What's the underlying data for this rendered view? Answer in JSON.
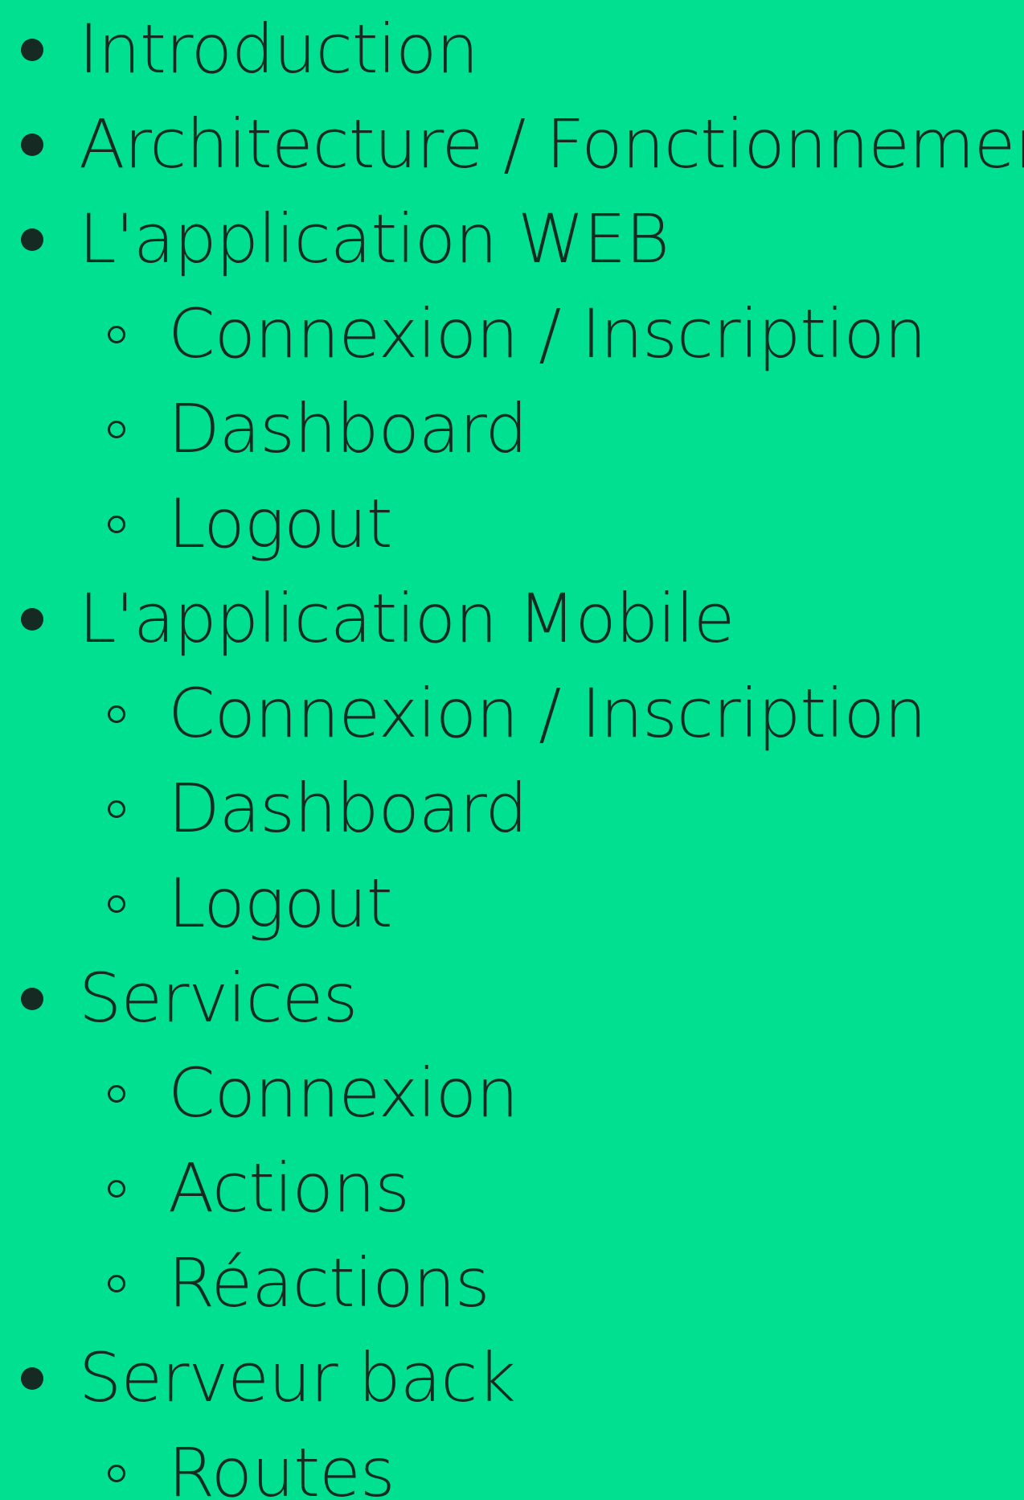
{
  "toc": {
    "items": [
      {
        "label": "Introduction",
        "level": 1,
        "icon": "disc-bullet-icon"
      },
      {
        "label": "Architecture / Fonctionnement",
        "level": 1,
        "icon": "disc-bullet-icon"
      },
      {
        "label": "L'application WEB",
        "level": 1,
        "icon": "disc-bullet-icon"
      },
      {
        "label": "Connexion / Inscription",
        "level": 2,
        "icon": "circle-bullet-icon"
      },
      {
        "label": "Dashboard",
        "level": 2,
        "icon": "circle-bullet-icon"
      },
      {
        "label": "Logout",
        "level": 2,
        "icon": "circle-bullet-icon"
      },
      {
        "label": "L'application Mobile",
        "level": 1,
        "icon": "disc-bullet-icon"
      },
      {
        "label": "Connexion / Inscription",
        "level": 2,
        "icon": "circle-bullet-icon"
      },
      {
        "label": "Dashboard",
        "level": 2,
        "icon": "circle-bullet-icon"
      },
      {
        "label": "Logout",
        "level": 2,
        "icon": "circle-bullet-icon"
      },
      {
        "label": "Services",
        "level": 1,
        "icon": "disc-bullet-icon"
      },
      {
        "label": "Connexion",
        "level": 2,
        "icon": "circle-bullet-icon"
      },
      {
        "label": "Actions",
        "level": 2,
        "icon": "circle-bullet-icon"
      },
      {
        "label": "Réactions",
        "level": 2,
        "icon": "circle-bullet-icon"
      },
      {
        "label": "Serveur back",
        "level": 1,
        "icon": "disc-bullet-icon"
      },
      {
        "label": "Routes",
        "level": 2,
        "icon": "circle-bullet-icon"
      }
    ]
  },
  "colors": {
    "background": "#00E091",
    "text": "#142A22"
  }
}
